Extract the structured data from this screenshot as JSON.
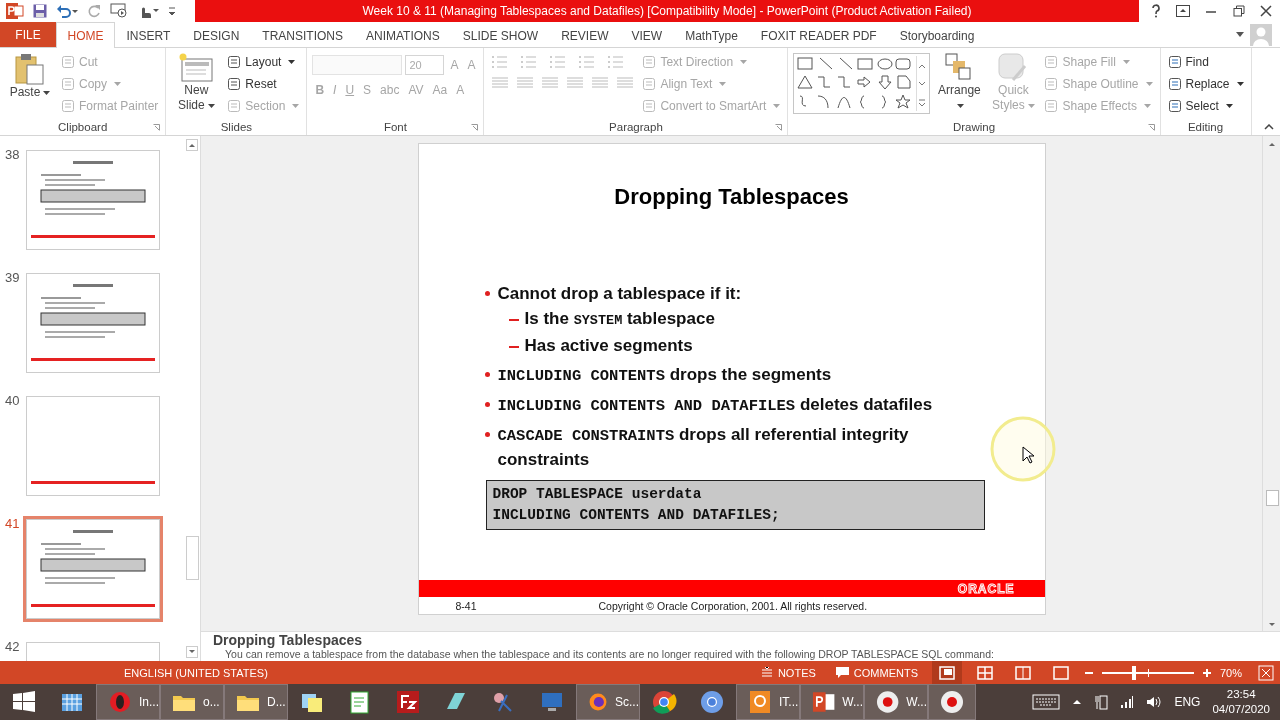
{
  "window": {
    "title": "Week 10 & 11 (Managing Tablespaces and Datafiles) [Compatibility Mode] -  PowerPoint (Product Activation Failed)"
  },
  "tabs": [
    {
      "label": "FILE",
      "kind": "file",
      "selected": false
    },
    {
      "label": "HOME",
      "kind": "tab",
      "selected": true
    },
    {
      "label": "INSERT",
      "kind": "tab",
      "selected": false
    },
    {
      "label": "DESIGN",
      "kind": "tab",
      "selected": false
    },
    {
      "label": "TRANSITIONS",
      "kind": "tab",
      "selected": false
    },
    {
      "label": "ANIMATIONS",
      "kind": "tab",
      "selected": false
    },
    {
      "label": "SLIDE SHOW",
      "kind": "tab",
      "selected": false
    },
    {
      "label": "REVIEW",
      "kind": "tab",
      "selected": false
    },
    {
      "label": "VIEW",
      "kind": "tab",
      "selected": false
    },
    {
      "label": "MathType",
      "kind": "tab",
      "selected": false
    },
    {
      "label": "FOXIT READER PDF",
      "kind": "tab",
      "selected": false
    },
    {
      "label": "Storyboarding",
      "kind": "tab",
      "selected": false
    }
  ],
  "ribbon": [
    {
      "label": "Clipboard",
      "columns": [
        {
          "kind": "large",
          "label": "Paste",
          "disabled": false,
          "dropdown": true
        },
        {
          "kind": "stack",
          "items": [
            {
              "label": "Cut",
              "disabled": true,
              "dropdown": false
            },
            {
              "label": "Copy",
              "disabled": true,
              "dropdown": true
            },
            {
              "label": "Format Painter",
              "disabled": true,
              "dropdown": false
            }
          ]
        }
      ]
    },
    {
      "label": "Slides",
      "columns": [
        {
          "kind": "large",
          "label": "New Slide",
          "disabled": false,
          "dropdown": true
        },
        {
          "kind": "stack",
          "items": [
            {
              "label": "Layout",
              "disabled": false,
              "dropdown": true
            },
            {
              "label": "Reset",
              "disabled": false,
              "dropdown": false
            },
            {
              "label": "Section",
              "disabled": true,
              "dropdown": true
            }
          ]
        }
      ]
    },
    {
      "label": "Font",
      "columns": [
        {
          "kind": "font",
          "size": "20",
          "grow": [
            "A",
            "A"
          ],
          "styles": [
            "B",
            "I",
            "U",
            "S",
            "abc",
            "AV",
            "Aa",
            "A"
          ],
          "disabled": true
        }
      ]
    },
    {
      "label": "Paragraph",
      "columns": [
        {
          "kind": "paragraph",
          "disabled": true
        },
        {
          "kind": "stack",
          "items": [
            {
              "label": "Text Direction",
              "disabled": true,
              "dropdown": true
            },
            {
              "label": "Align Text",
              "disabled": true,
              "dropdown": true
            },
            {
              "label": "Convert to SmartArt",
              "disabled": true,
              "dropdown": true
            }
          ]
        }
      ]
    },
    {
      "label": "Drawing",
      "columns": [
        {
          "kind": "gallery"
        },
        {
          "kind": "large",
          "label": "Arrange",
          "disabled": false,
          "dropdown": true
        },
        {
          "kind": "large",
          "label": "Quick Styles",
          "disabled": true,
          "dropdown": true
        },
        {
          "kind": "stack",
          "items": [
            {
              "label": "Shape Fill",
              "disabled": true,
              "dropdown": true
            },
            {
              "label": "Shape Outline",
              "disabled": true,
              "dropdown": true
            },
            {
              "label": "Shape Effects",
              "disabled": true,
              "dropdown": true
            }
          ]
        }
      ]
    },
    {
      "label": "Editing",
      "columns": [
        {
          "kind": "stack",
          "items": [
            {
              "label": "Find",
              "disabled": false,
              "dropdown": false
            },
            {
              "label": "Replace",
              "disabled": false,
              "dropdown": true
            },
            {
              "label": "Select",
              "disabled": false,
              "dropdown": true
            }
          ]
        }
      ]
    }
  ],
  "thumbnails": [
    {
      "number": "38",
      "kind": "content",
      "selected": false
    },
    {
      "number": "39",
      "kind": "content",
      "selected": false
    },
    {
      "number": "40",
      "kind": "blank",
      "selected": false
    },
    {
      "number": "41",
      "kind": "content",
      "selected": true
    },
    {
      "number": "42",
      "kind": "blank",
      "selected": false
    }
  ],
  "slide": {
    "title": "Dropping Tablespaces",
    "bullets": [
      {
        "parts": [
          {
            "text": "Cannot drop a tablespace if it:",
            "code": false
          }
        ],
        "children": [
          {
            "parts": [
              {
                "text": "Is the ",
                "code": false
              },
              {
                "text": "SYSTEM",
                "code": true
              },
              {
                "text": " tablespace",
                "code": false
              }
            ]
          },
          {
            "parts": [
              {
                "text": "Has active segments",
                "code": false
              }
            ]
          }
        ]
      },
      {
        "parts": [
          {
            "text": "INCLUDING CONTENTS",
            "code": true
          },
          {
            "text": " drops the segments",
            "code": false
          }
        ]
      },
      {
        "parts": [
          {
            "text": "INCLUDING CONTENTS AND DATAFILES",
            "code": true
          },
          {
            "text": " deletes datafiles",
            "code": false
          }
        ]
      },
      {
        "parts": [
          {
            "text": "CASCADE CONSTRAINTS",
            "code": true
          },
          {
            "text": " drops all referential integrity constraints",
            "code": false
          }
        ]
      }
    ],
    "code": [
      "DROP TABLESPACE userdata",
      "INCLUDING CONTENTS AND DATAFILES;"
    ],
    "logo": "ORACLE",
    "page": "8-41",
    "copyright": "Copyright © Oracle Corporation, 2001. All rights reserved."
  },
  "notes": {
    "title": "Dropping Tablespaces",
    "text": "You can remove a tablespace from the database when the tablespace and its contents are no longer required with the following DROP TABLESPACE SQL command:"
  },
  "status_bar": {
    "language": "ENGLISH (UNITED STATES)",
    "notes": "NOTES",
    "comments": "COMMENTS",
    "views": [
      {
        "selected": true
      },
      {
        "selected": false
      },
      {
        "selected": false
      },
      {
        "selected": false
      }
    ],
    "zoom": {
      "level": 0.35,
      "reading": "70%"
    }
  },
  "taskbar": {
    "items": [
      {
        "kind": "start",
        "open": false
      },
      {
        "kind": "calendar",
        "open": false
      },
      {
        "kind": "opera",
        "label": "In...",
        "open": true
      },
      {
        "kind": "folder",
        "label": "o...",
        "open": true
      },
      {
        "kind": "folder",
        "label": "D...",
        "open": true
      },
      {
        "kind": "notes",
        "open": false
      },
      {
        "kind": "editor",
        "open": false
      },
      {
        "kind": "ftp",
        "open": false
      },
      {
        "kind": "glass",
        "open": false
      },
      {
        "kind": "tool",
        "open": false
      },
      {
        "kind": "monitor",
        "open": false
      },
      {
        "kind": "firefox",
        "label": "Sc...",
        "open": true
      },
      {
        "kind": "chrome",
        "open": false
      },
      {
        "kind": "chromium",
        "open": false
      },
      {
        "kind": "pdf",
        "label": "IT...",
        "open": true
      },
      {
        "kind": "slides",
        "label": "W...",
        "open": true
      },
      {
        "kind": "record",
        "label": "W...",
        "open": true
      },
      {
        "kind": "record",
        "open": true
      }
    ],
    "language": "ENG",
    "time": "23:54",
    "date": "04/07/2020"
  }
}
